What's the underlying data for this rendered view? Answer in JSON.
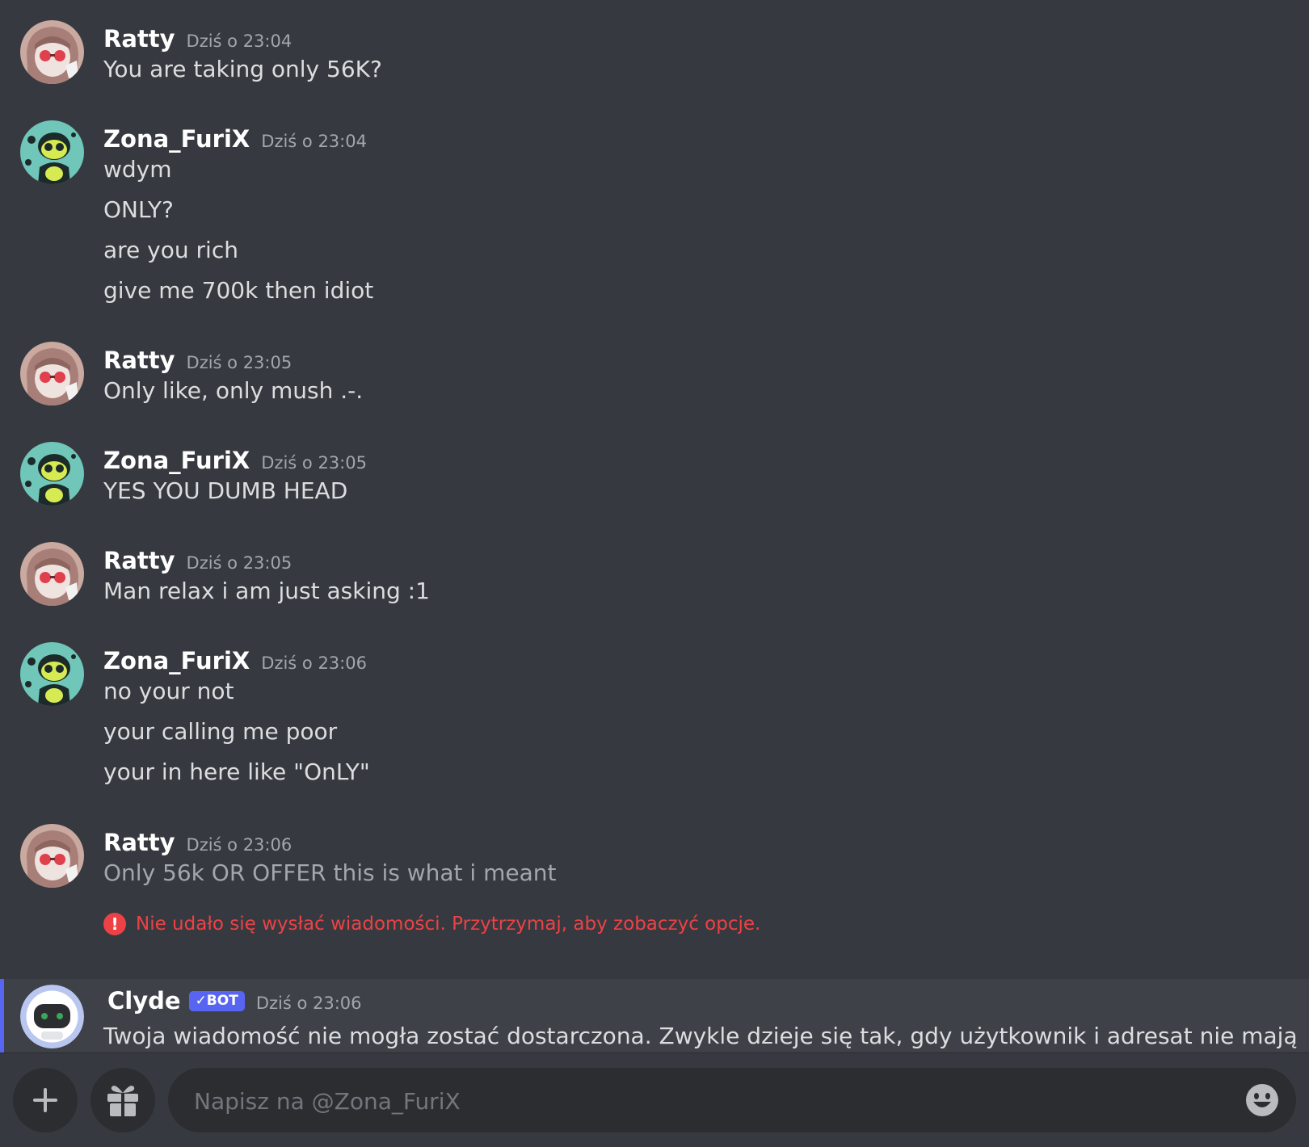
{
  "messages": [
    {
      "author": "Ratty",
      "time": "Dziś o 23:04",
      "lines": [
        "You are taking only 56K?"
      ]
    },
    {
      "author": "Zona_FuriX",
      "time": "Dziś o 23:04",
      "lines": [
        "wdym",
        "ONLY?",
        "are you rich",
        "give me 700k then idiot"
      ]
    },
    {
      "author": "Ratty",
      "time": "Dziś o 23:05",
      "lines": [
        "Only like, only mush .-."
      ]
    },
    {
      "author": "Zona_FuriX",
      "time": "Dziś o 23:05",
      "lines": [
        "YES YOU DUMB HEAD"
      ]
    },
    {
      "author": "Ratty",
      "time": "Dziś o 23:05",
      "lines": [
        "Man relax i am just asking :1"
      ]
    },
    {
      "author": "Zona_FuriX",
      "time": "Dziś o 23:06",
      "lines": [
        "no your not",
        "your calling me poor",
        "your in here like \"OnLY\""
      ]
    },
    {
      "author": "Ratty",
      "time": "Dziś o 23:06",
      "lines": [
        "Only 56k OR OFFER this is what i meant"
      ],
      "error": "Nie udało się wysłać wiadomości. Przytrzymaj, aby zobaczyć opcje."
    }
  ],
  "clyde": {
    "author": "Clyde",
    "badge": "✓BOT",
    "time": "Dziś o 23:06",
    "text": "Twoja wiadomość nie mogła zostać dostarczona. Zwykle dzieje się tak, gdy użytkownik i adresat nie mają"
  },
  "composer": {
    "placeholder": "Napisz na @Zona_FuriX",
    "icons": [
      "plus-icon",
      "gift-icon",
      "emoji-icon"
    ]
  },
  "colors": {
    "background": "#36393f",
    "error": "#ed4245",
    "blurple": "#5865f2"
  }
}
